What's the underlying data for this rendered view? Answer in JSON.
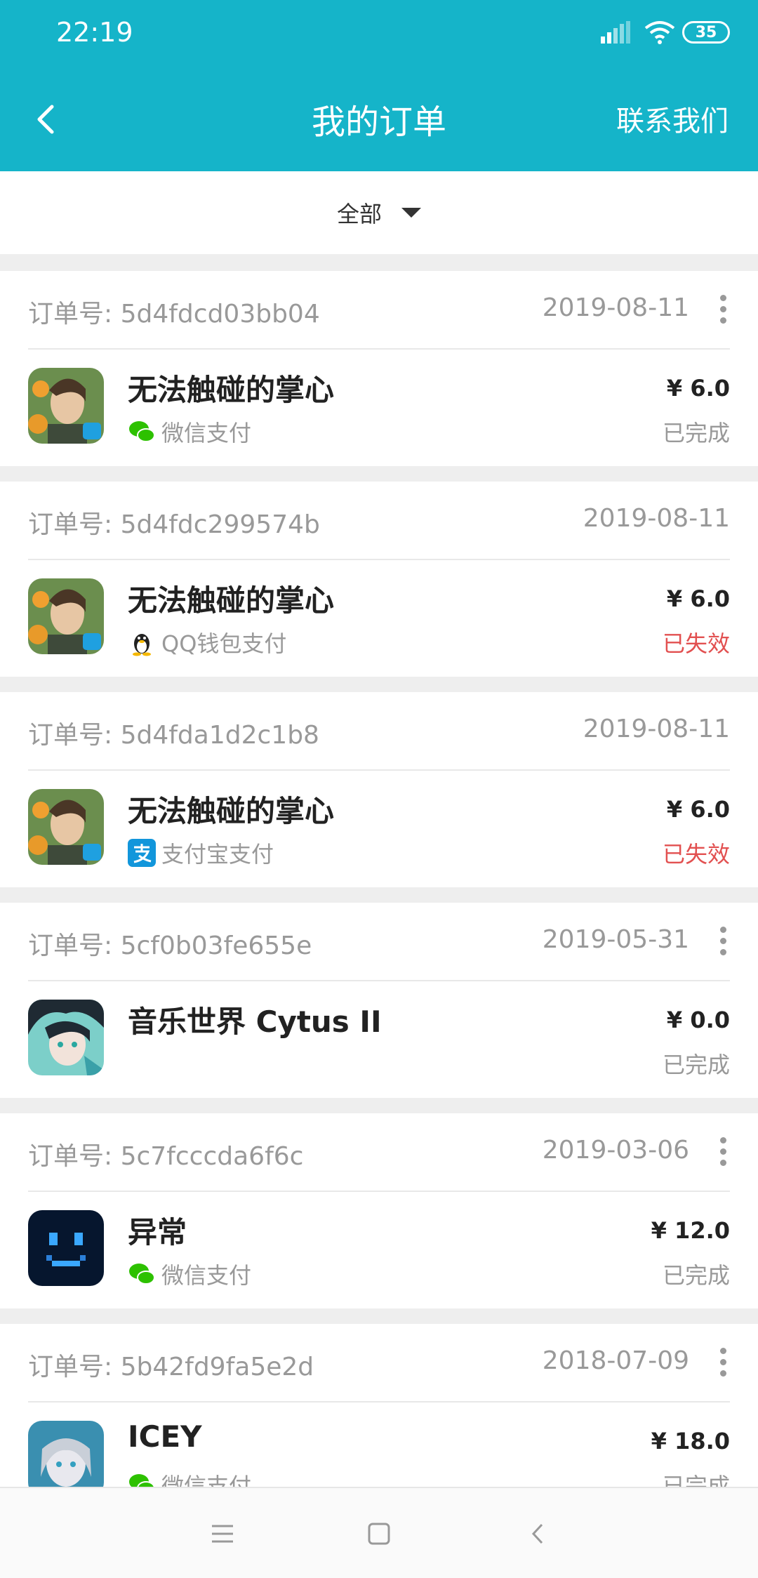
{
  "status_bar": {
    "time": "22:19",
    "battery": "35"
  },
  "header": {
    "title": "我的订单",
    "contact_label": "联系我们"
  },
  "filter": {
    "selected": "全部"
  },
  "orders": [
    {
      "order_label": "订单号:",
      "order_id": "5d4fdcd03bb04",
      "date": "2019-08-11",
      "name": "无法触碰的掌心",
      "payment": "微信支付",
      "price": "¥ 6.0",
      "status": "已完成"
    },
    {
      "order_label": "订单号:",
      "order_id": "5d4fdc299574b",
      "date": "2019-08-11",
      "name": "无法触碰的掌心",
      "payment": "QQ钱包支付",
      "price": "¥ 6.0",
      "status": "已失效"
    },
    {
      "order_label": "订单号:",
      "order_id": "5d4fda1d2c1b8",
      "date": "2019-08-11",
      "name": "无法触碰的掌心",
      "payment": "支付宝支付",
      "price": "¥ 6.0",
      "status": "已失效"
    },
    {
      "order_label": "订单号:",
      "order_id": "5cf0b03fe655e",
      "date": "2019-05-31",
      "name": "音乐世界 Cytus II",
      "payment": "",
      "price": "¥ 0.0",
      "status": "已完成"
    },
    {
      "order_label": "订单号:",
      "order_id": "5c7fcccda6f6c",
      "date": "2019-03-06",
      "name": "异常",
      "payment": "微信支付",
      "price": "¥ 12.0",
      "status": "已完成"
    },
    {
      "order_label": "订单号:",
      "order_id": "5b42fd9fa5e2d",
      "date": "2018-07-09",
      "name": "ICEY",
      "payment": "微信支付",
      "price": "¥ 18.0",
      "status": "已完成"
    }
  ],
  "colors": {
    "header_bg": "#15b4c9",
    "failed_status": "#e25050",
    "wechat": "#2dc100",
    "alipay": "#1296db"
  }
}
